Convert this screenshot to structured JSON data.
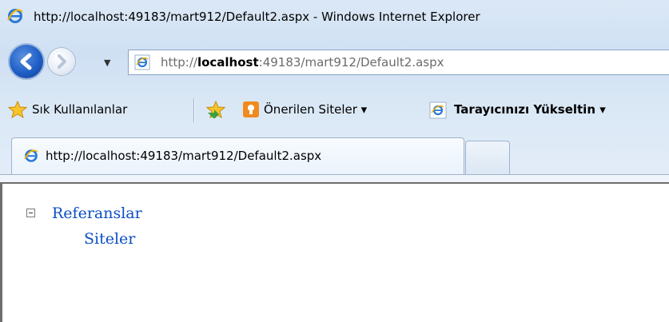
{
  "window": {
    "title": "http://localhost:49183/mart912/Default2.aspx - Windows Internet Explorer"
  },
  "navigation": {
    "address_prefix": "http://",
    "address_host": "localhost",
    "address_rest": ":49183/mart912/Default2.aspx"
  },
  "favorites_bar": {
    "favorites_label": "Sık Kullanılanlar",
    "suggested_sites_label": "Önerilen Siteler ▾",
    "upgrade_label": "Tarayıcınızı Yükseltin ▾"
  },
  "tabs": [
    {
      "label": "http://localhost:49183/mart912/Default2.aspx"
    }
  ],
  "tree": {
    "root": "Referanslar",
    "children": [
      "Siteler"
    ]
  },
  "colors": {
    "link": "#0b4fc3",
    "chrome": "#d9e7f5"
  }
}
